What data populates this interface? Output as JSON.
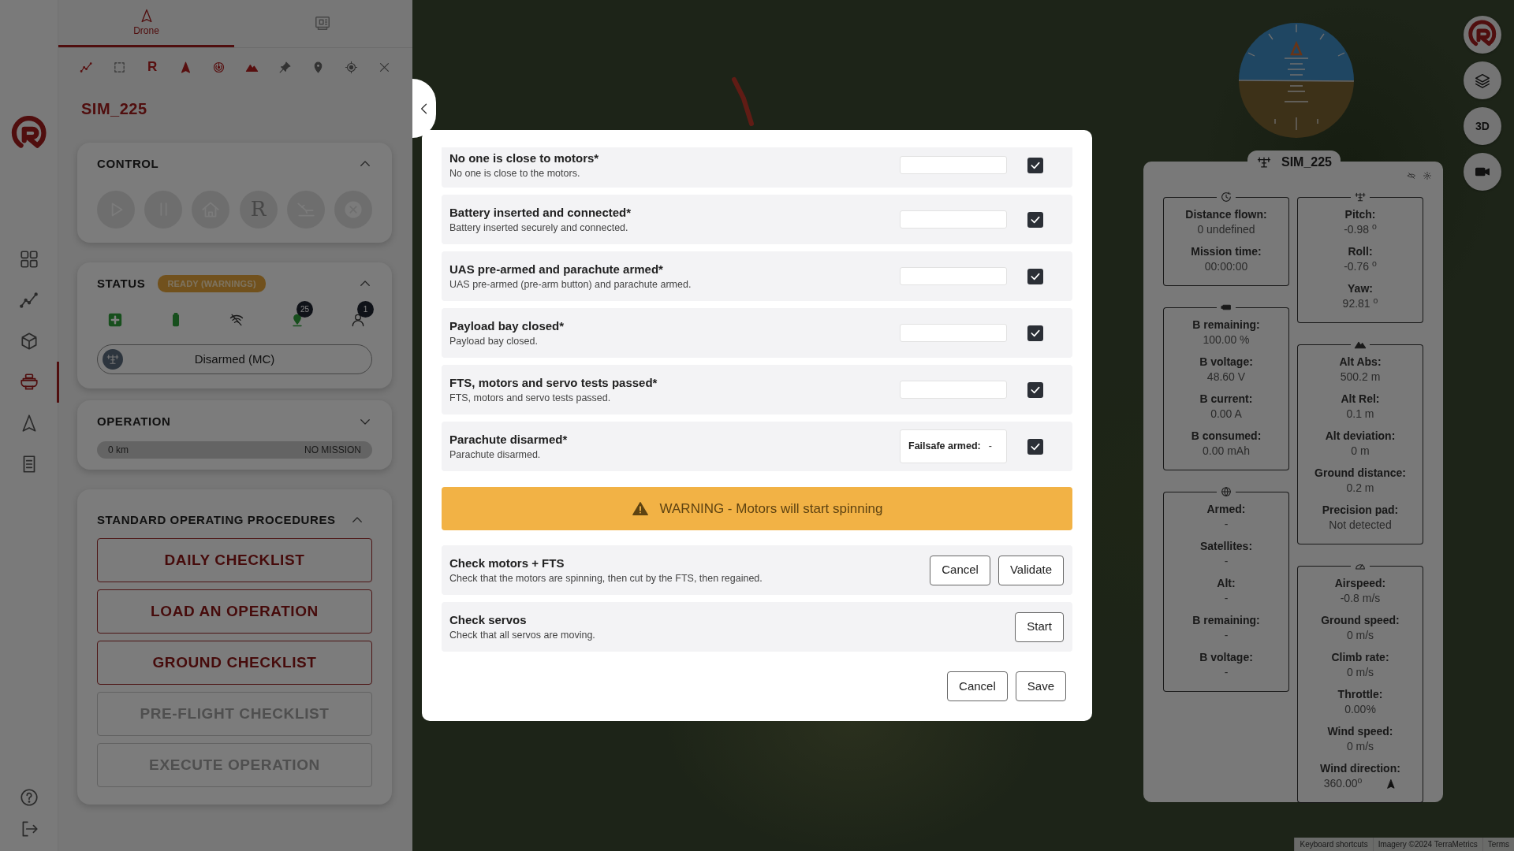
{
  "rail": {
    "items": [
      {
        "kind": "grid",
        "selected": false
      },
      {
        "kind": "chart",
        "selected": false
      },
      {
        "kind": "cube",
        "selected": false
      },
      {
        "kind": "drone",
        "selected": true
      },
      {
        "kind": "nav",
        "selected": false
      },
      {
        "kind": "doc",
        "selected": false
      }
    ],
    "bottom": [
      {
        "kind": "help"
      },
      {
        "kind": "logout"
      }
    ]
  },
  "panel": {
    "tabs": [
      {
        "kind": "drone",
        "label": "Drone",
        "selected": true
      },
      {
        "kind": "station",
        "selected": false
      }
    ],
    "toolbar": [
      {
        "kind": "chart",
        "on": true
      },
      {
        "kind": "select",
        "on": false
      },
      {
        "kind": "text",
        "label": "R",
        "on": true
      },
      {
        "kind": "nav",
        "on": true
      },
      {
        "kind": "radar",
        "on": true
      },
      {
        "kind": "mountain",
        "on": true
      },
      {
        "kind": "pin",
        "on": false
      },
      {
        "kind": "marker",
        "on": false
      },
      {
        "kind": "target",
        "on": false
      },
      {
        "kind": "close",
        "on": false
      }
    ],
    "vehicle_name": "SIM_225",
    "control": {
      "title": "CONTROL",
      "expanded": true,
      "buttons": [
        {
          "kind": "play",
          "disabled": true
        },
        {
          "kind": "pause",
          "disabled": true
        },
        {
          "kind": "home",
          "disabled": true
        },
        {
          "kind": "text",
          "label": "R",
          "disabled": true
        },
        {
          "kind": "land",
          "disabled": true
        },
        {
          "kind": "abort",
          "disabled": true
        }
      ]
    },
    "status": {
      "title": "STATUS",
      "badge": "READY (WARNINGS)",
      "expanded": true,
      "indicators": [
        {
          "kind": "health"
        },
        {
          "kind": "battery"
        },
        {
          "kind": "nolink"
        },
        {
          "kind": "gps",
          "count": "25"
        },
        {
          "kind": "pilot",
          "count": "1"
        }
      ],
      "mode": "Disarmed (MC)"
    },
    "operation": {
      "title": "OPERATION",
      "expanded": false,
      "level": 0,
      "distance": "0 km",
      "mission": "NO MISSION"
    },
    "sop": {
      "title": "STANDARD OPERATING PROCEDURES",
      "expanded": true,
      "buttons": [
        {
          "label": "DAILY CHECKLIST",
          "disabled": false
        },
        {
          "label": "LOAD AN OPERATION",
          "disabled": false
        },
        {
          "label": "GROUND CHECKLIST",
          "disabled": false
        },
        {
          "label": "PRE-FLIGHT CHECKLIST",
          "disabled": true
        },
        {
          "label": "EXECUTE OPERATION",
          "disabled": true
        }
      ]
    }
  },
  "map": {
    "buttons": [
      {
        "kind": "logo"
      },
      {
        "kind": "layers"
      },
      {
        "kind": "text",
        "label": "3D"
      },
      {
        "kind": "camera"
      }
    ],
    "attribution": [
      "Keyboard shortcuts",
      "Imagery ©2024 TerraMetrics",
      "Terms"
    ]
  },
  "telemetry": {
    "title": "SIM_225",
    "columns": [
      [
        {
          "kind": "clock",
          "fields": [
            {
              "kind": "plain",
              "label": "Distance flown:",
              "value": "0 undefined"
            },
            {
              "kind": "plain",
              "label": "Mission time:",
              "value": "00:00:00"
            }
          ]
        },
        {
          "kind": "battery",
          "fields": [
            {
              "kind": "plain",
              "label": "B remaining:",
              "value": "100.00 %"
            },
            {
              "kind": "plain",
              "label": "B voltage:",
              "value": "48.60 V"
            },
            {
              "kind": "plain",
              "label": "B current:",
              "value": "0.00 A"
            },
            {
              "kind": "plain",
              "label": "B consumed:",
              "value": "0.00 mAh"
            }
          ]
        },
        {
          "kind": "globe",
          "fields": [
            {
              "kind": "plain",
              "label": "Armed:",
              "value": "-"
            },
            {
              "kind": "plain",
              "label": "Satellites:",
              "value": "-"
            },
            {
              "kind": "plain",
              "label": "Alt:",
              "value": "-"
            },
            {
              "kind": "plain",
              "label": "B remaining:",
              "value": "-"
            },
            {
              "kind": "plain",
              "label": "B voltage:",
              "value": "-"
            }
          ]
        }
      ],
      [
        {
          "kind": "drone",
          "fields": [
            {
              "kind": "plain",
              "label": "Pitch:",
              "value": "-0.98 $^{o}$"
            },
            {
              "kind": "plain",
              "label": "Roll:",
              "value": "-0.76 $^{o}$"
            },
            {
              "kind": "plain",
              "label": "Yaw:",
              "value": "92.81 $^{o}$"
            }
          ]
        },
        {
          "kind": "mountain",
          "fields": [
            {
              "kind": "plain",
              "label": "Alt Abs:",
              "value": "500.2 m"
            },
            {
              "kind": "plain",
              "label": "Alt Rel:",
              "value": "0.1 m"
            },
            {
              "kind": "plain",
              "label": "Alt deviation:",
              "value": "0 m"
            },
            {
              "kind": "plain",
              "label": "Ground distance:",
              "value": "0.2 m"
            },
            {
              "kind": "plain",
              "label": "Precision pad:",
              "value": "Not detected"
            }
          ]
        },
        {
          "kind": "gauge",
          "fields": [
            {
              "kind": "plain",
              "label": "Airspeed:",
              "value": "-0.8 m/s"
            },
            {
              "kind": "plain",
              "label": "Ground speed:",
              "value": "0 m/s"
            },
            {
              "kind": "plain",
              "label": "Climb rate:",
              "value": "0 m/s"
            },
            {
              "kind": "plain",
              "label": "Throttle:",
              "value": "0.00%"
            },
            {
              "kind": "plain",
              "label": "Wind speed:",
              "value": "0 m/s"
            },
            {
              "kind": "heading",
              "label": "Wind direction:",
              "value": "360.00$^{o}$"
            }
          ]
        }
      ]
    ]
  },
  "modal": {
    "items": [
      {
        "kind": "field",
        "title": "No one is close to motors*",
        "description": "No one is close to the motors.",
        "checked": true
      },
      {
        "kind": "field",
        "title": "Battery inserted and connected*",
        "description": "Battery inserted securely and connected.",
        "checked": true
      },
      {
        "kind": "field",
        "title": "UAS pre-armed and parachute armed*",
        "description": "UAS pre-armed (pre-arm button) and parachute armed.",
        "checked": true
      },
      {
        "kind": "field",
        "title": "Payload bay closed*",
        "description": "Payload bay closed.",
        "checked": true
      },
      {
        "kind": "field",
        "title": "FTS, motors and servo tests passed*",
        "description": "FTS, motors and servo tests passed.",
        "checked": true
      },
      {
        "kind": "readout",
        "title": "Parachute disarmed*",
        "description": "Parachute disarmed.",
        "readout_label": "Failsafe armed:",
        "readout_value": "-",
        "checked": true
      }
    ],
    "warning": "WARNING - Motors will start spinning",
    "tests": [
      {
        "title": "Check motors + FTS",
        "description": "Check that the motors are spinning, then cut by the FTS, then regained.",
        "buttons": [
          "Cancel",
          "Validate"
        ]
      },
      {
        "title": "Check servos",
        "description": "Check that all servos are moving.",
        "buttons": [
          "Start"
        ]
      }
    ],
    "footer": [
      "Cancel",
      "Save"
    ]
  }
}
